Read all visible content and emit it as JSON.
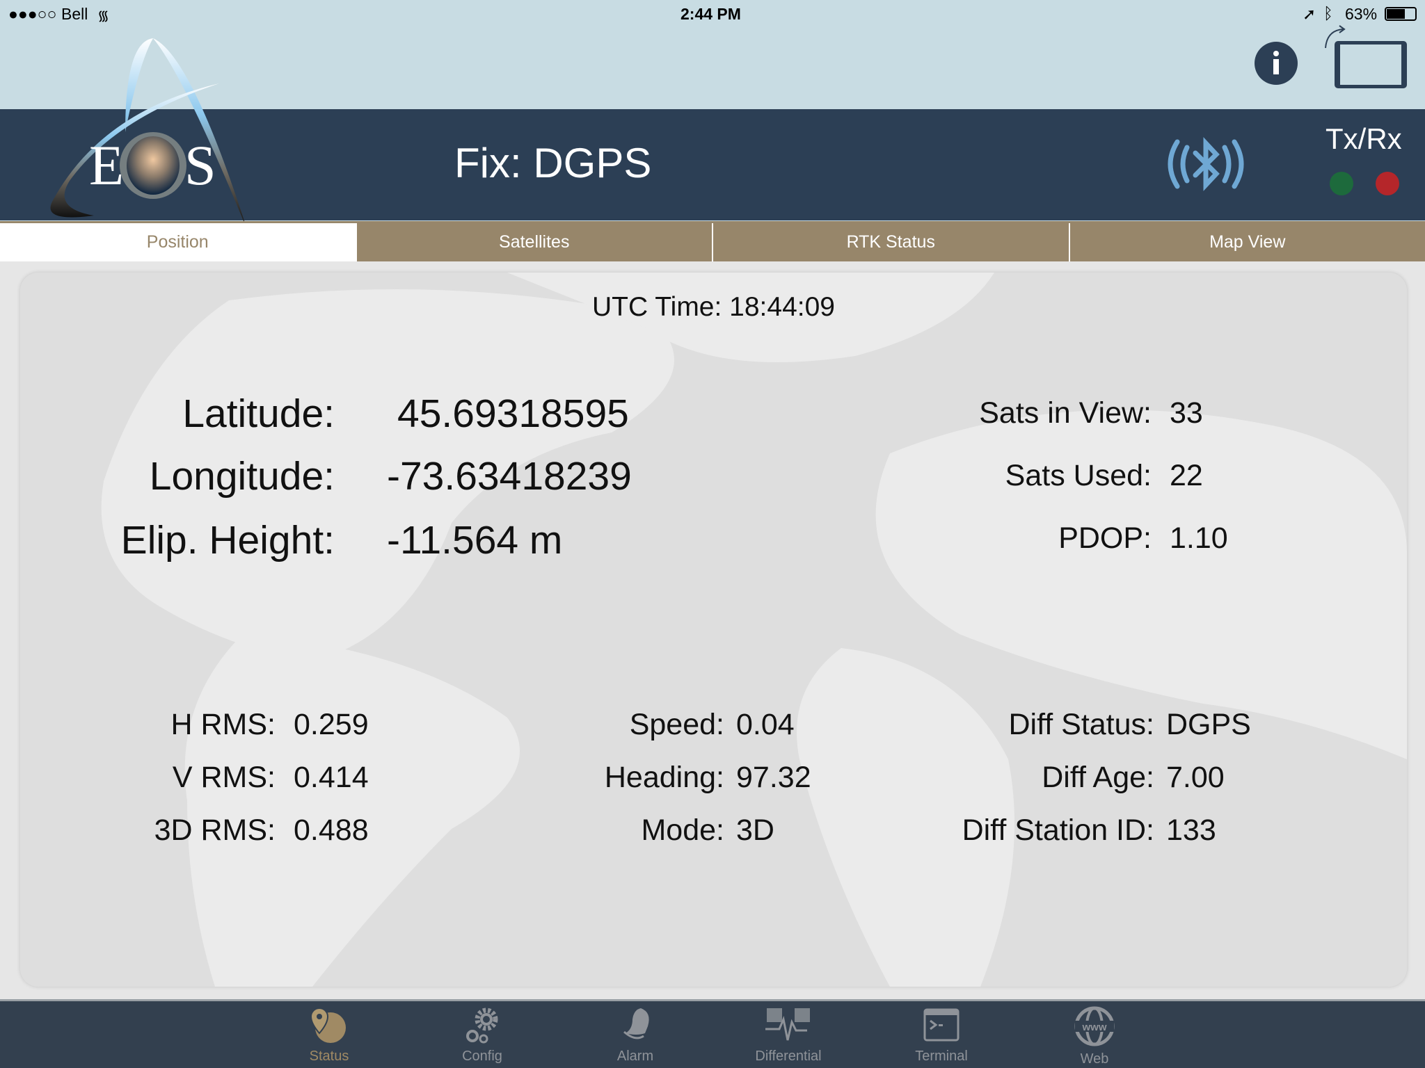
{
  "status_bar": {
    "carrier": "Bell",
    "signal": "●●●○○",
    "time": "2:44 PM",
    "battery": "63%"
  },
  "header": {
    "logo_text": "EOS",
    "fix": "Fix: DGPS",
    "txrx": "Tx/Rx",
    "tx_color": "#1d6a3c",
    "rx_color": "#b5262a",
    "icons": [
      "info-icon",
      "rotate-device-icon",
      "bluetooth-icon"
    ]
  },
  "tabs": [
    {
      "label": "Position",
      "active": true
    },
    {
      "label": "Satellites"
    },
    {
      "label": "RTK Status"
    },
    {
      "label": "Map View"
    }
  ],
  "position": {
    "utc": "UTC Time: 18:44:09",
    "latitude": {
      "label": "Latitude:",
      "value": "45.69318595"
    },
    "longitude": {
      "label": "Longitude:",
      "value": "-73.63418239"
    },
    "height": {
      "label": "Elip. Height:",
      "value": "-11.564 m"
    },
    "sats_in_view": {
      "label": "Sats in View:",
      "value": "33"
    },
    "sats_used": {
      "label": "Sats Used:",
      "value": "22"
    },
    "pdop": {
      "label": "PDOP:",
      "value": "1.10"
    },
    "hrms": {
      "label": "H RMS:",
      "value": "0.259"
    },
    "vrms": {
      "label": "V RMS:",
      "value": "0.414"
    },
    "rms3d": {
      "label": "3D RMS:",
      "value": "0.488"
    },
    "speed": {
      "label": "Speed:",
      "value": "0.04"
    },
    "heading": {
      "label": "Heading:",
      "value": "97.32"
    },
    "mode": {
      "label": "Mode:",
      "value": "3D"
    },
    "diff_status": {
      "label": "Diff Status:",
      "value": "DGPS"
    },
    "diff_age": {
      "label": "Diff Age:",
      "value": "7.00"
    },
    "diff_station": {
      "label": "Diff Station ID:",
      "value": "133"
    }
  },
  "bottom_nav": [
    {
      "label": "Status",
      "active": true
    },
    {
      "label": "Config"
    },
    {
      "label": "Alarm"
    },
    {
      "label": "Differential"
    },
    {
      "label": "Terminal"
    },
    {
      "label": "Web"
    }
  ],
  "colors": {
    "navy": "#2c3f55",
    "tab": "#97866a",
    "accent": "#a08a64"
  }
}
